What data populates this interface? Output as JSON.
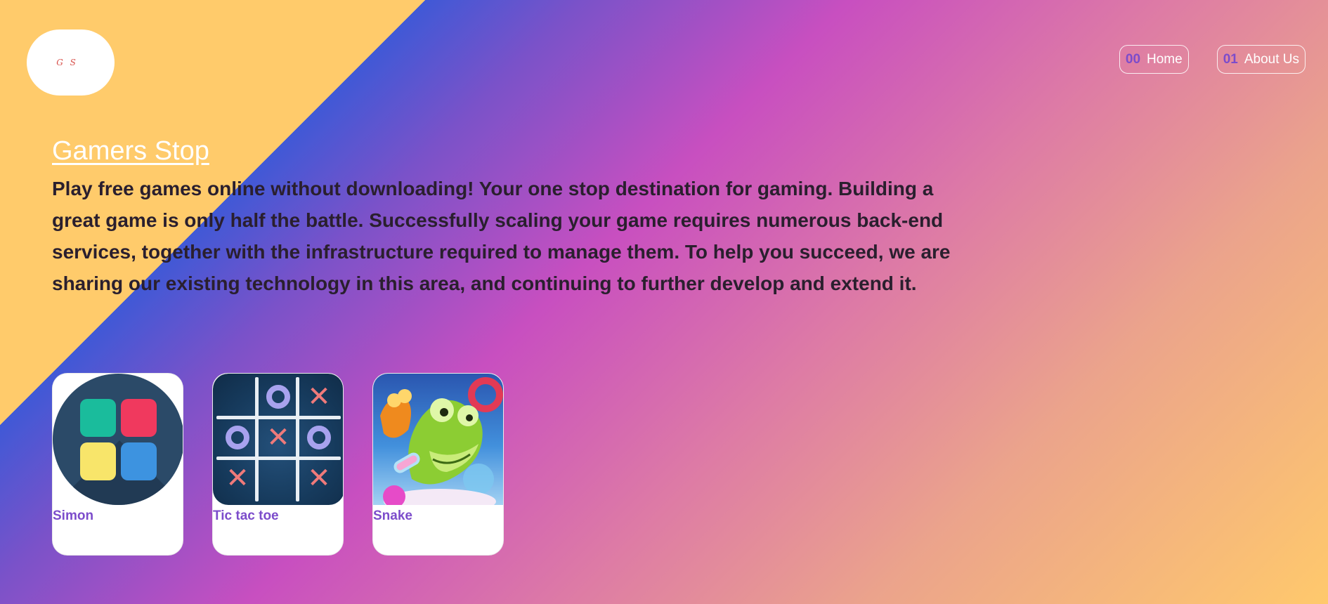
{
  "header": {
    "logo_text": "G S",
    "nav": [
      {
        "number": "00",
        "label": "Home"
      },
      {
        "number": "01",
        "label": "About Us"
      }
    ]
  },
  "hero": {
    "title": "Gamers Stop",
    "description": "Play free games online without downloading! Your one stop destination for gaming. Building a great game is only half the battle. Successfully scaling your game requires numerous back-end services, together with the infrastructure required to manage them. To help you succeed, we are sharing our existing technology in this area, and continuing to further develop and extend it."
  },
  "games": [
    {
      "title": "Simon",
      "icon": "simon-icon"
    },
    {
      "title": "Tic tac toe",
      "icon": "tic-tac-toe-icon"
    },
    {
      "title": "Snake",
      "icon": "snake-game-artwork"
    }
  ],
  "colors": {
    "accent_purple": "#7c4ccb",
    "gradient_yellow": "#ffcb6b",
    "gradient_blue": "#4059d6",
    "gradient_magenta": "#c84fc0"
  }
}
